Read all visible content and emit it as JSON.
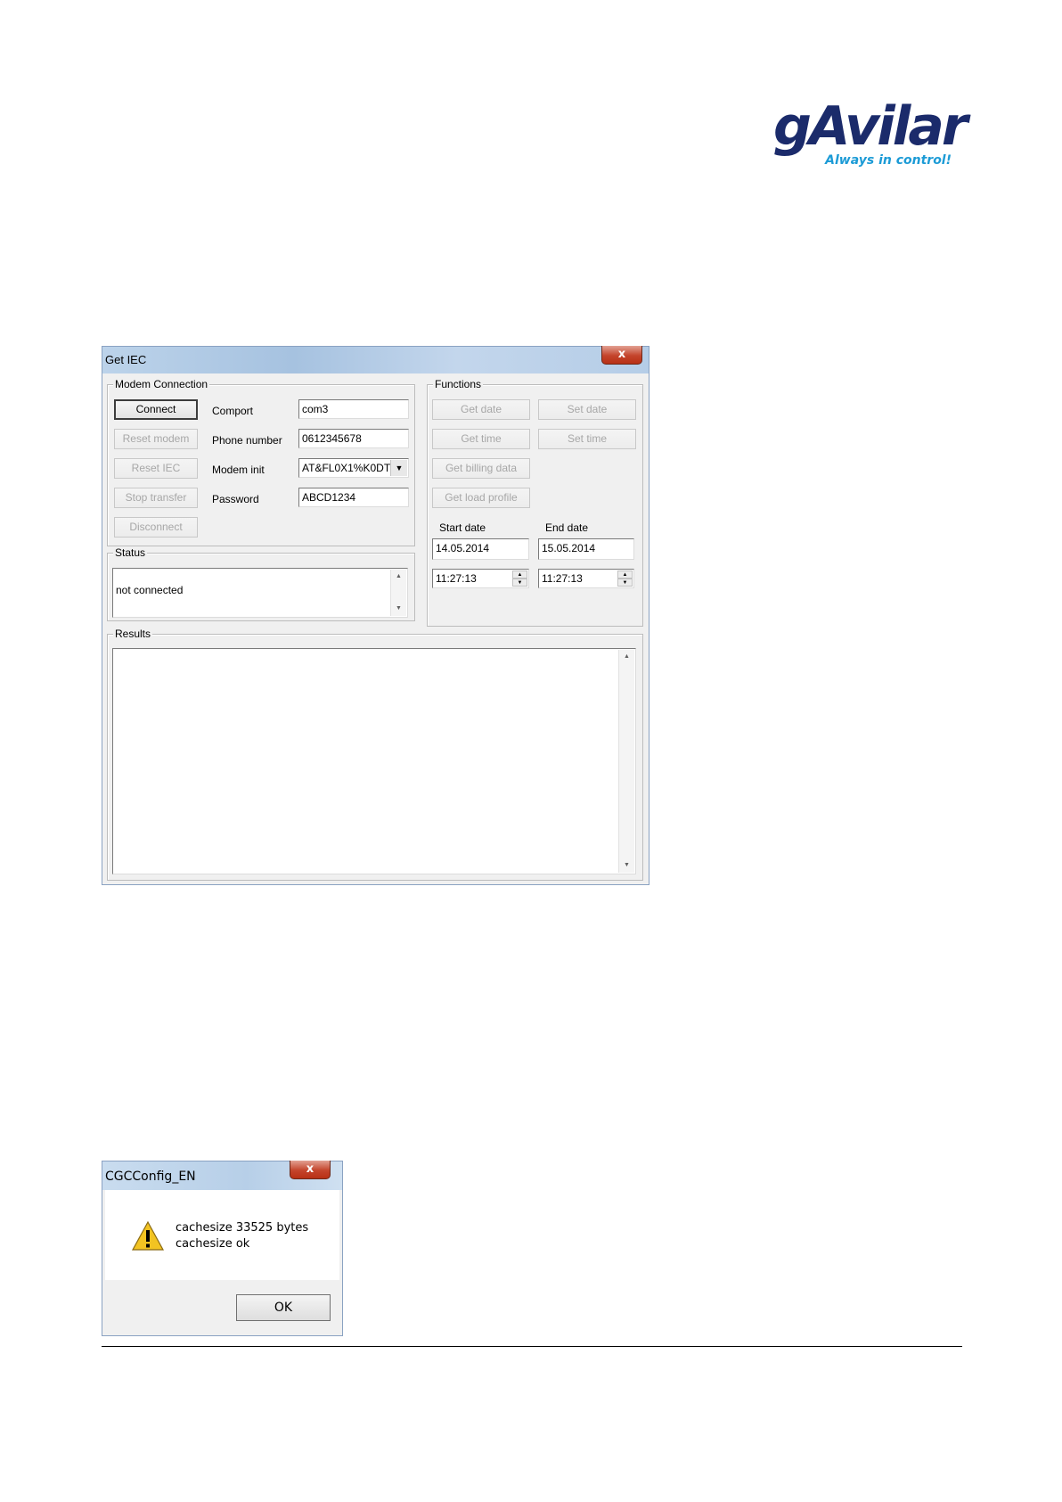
{
  "logo": {
    "brand": "gAvilar",
    "tagline": "Always in control!",
    "colors": {
      "brand": "#1b2b6b",
      "tagline": "#1c9bd6"
    }
  },
  "get_iec_window": {
    "title": "Get IEC",
    "close_label": "x",
    "modem_connection": {
      "legend": "Modem Connection",
      "buttons": {
        "connect": "Connect",
        "reset_modem": "Reset modem",
        "reset_iec": "Reset IEC",
        "stop_transfer": "Stop transfer",
        "disconnect": "Disconnect"
      },
      "comport": {
        "label": "Comport",
        "value": "com3"
      },
      "phone_number": {
        "label": "Phone number",
        "value": "0612345678"
      },
      "modem_init": {
        "label": "Modem init",
        "value": "AT&FL0X1%K0DT",
        "dropdown_icon": "chevron-down-icon"
      },
      "password": {
        "label": "Password",
        "value": "ABCD1234"
      }
    },
    "functions": {
      "legend": "Functions",
      "buttons": {
        "get_date": "Get date",
        "set_date": "Set date",
        "get_time": "Get time",
        "set_time": "Set time",
        "get_billing_data": "Get billing data",
        "get_load_profile": "Get load profile"
      },
      "start_date": {
        "label": "Start date",
        "value": "14.05.2014",
        "time": "11:27:13"
      },
      "end_date": {
        "label": "End date",
        "value": "15.05.2014",
        "time": "11:27:13"
      }
    },
    "status": {
      "legend": "Status",
      "text": "not connected"
    },
    "results": {
      "legend": "Results",
      "text": ""
    }
  },
  "message_box": {
    "title": "CGCConfig_EN",
    "close_label": "x",
    "icon": "warning-icon",
    "lines": [
      "cachesize 33525 bytes",
      "cachesize ok"
    ],
    "ok_label": "OK"
  }
}
